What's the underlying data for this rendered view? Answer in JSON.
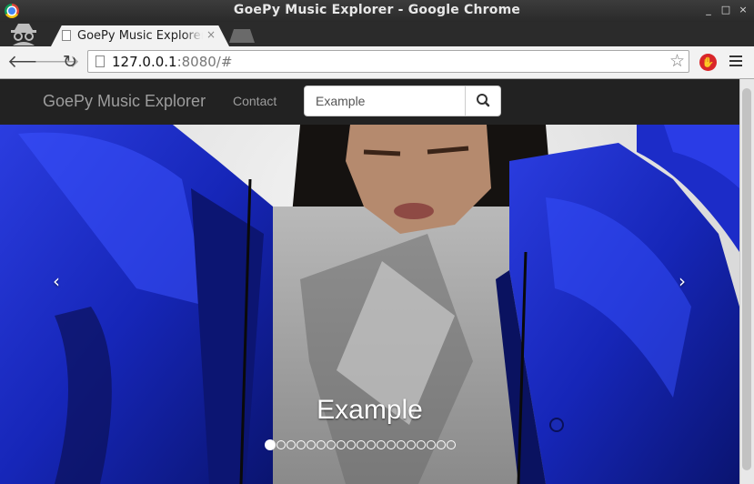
{
  "window": {
    "title": "GoePy Music Explorer - Google Chrome"
  },
  "tab": {
    "title": "GoePy Music Explorer",
    "close": "×"
  },
  "address_bar": {
    "url_host": "127.0.0.1",
    "url_rest": ":8080/#"
  },
  "navbar": {
    "brand": "GoePy Music Explorer",
    "contact_label": "Contact",
    "search_placeholder": "Example"
  },
  "carousel": {
    "caption": "Example",
    "prev_label": "‹",
    "next_label": "›",
    "indicator_count": 19,
    "active_index": 0
  },
  "colors": {
    "navbar_bg": "#222222",
    "jacket_blue": "#1d2fd0"
  }
}
